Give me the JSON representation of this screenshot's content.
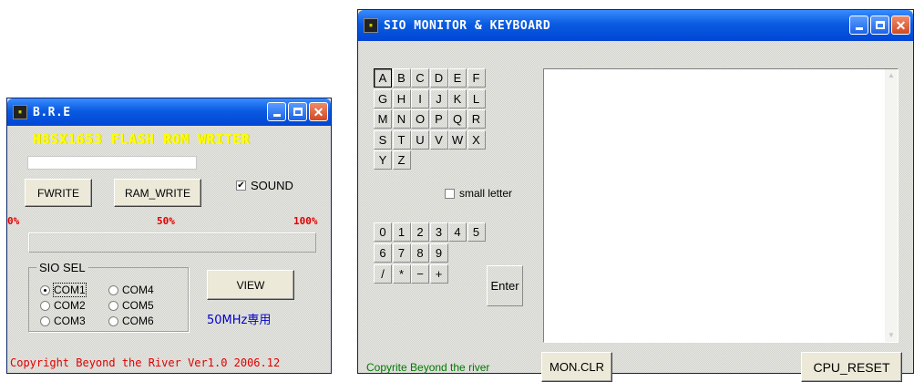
{
  "bre": {
    "title": "B.R.E",
    "header": "H8SX1653 FLASH ROM WRITER",
    "fwrite_label": "FWRITE",
    "ramwrite_label": "RAM_WRITE",
    "sound_label": "SOUND",
    "sound_checked": true,
    "scale": [
      "0%",
      "50%",
      "100%"
    ],
    "progress": 0,
    "sio_group_label": "SIO SEL",
    "com_ports": [
      "COM1",
      "COM2",
      "COM3",
      "COM4",
      "COM5",
      "COM6"
    ],
    "selected_com": "COM1",
    "view_label": "VIEW",
    "mhz_note": "50MHz専用",
    "copyright": "Copyright Beyond the River Ver1.0 2006.12"
  },
  "sio": {
    "title": "SIO MONITOR & KEYBOARD",
    "letter_keys": [
      "A",
      "B",
      "C",
      "D",
      "E",
      "F",
      "G",
      "H",
      "I",
      "J",
      "K",
      "L",
      "M",
      "N",
      "O",
      "P",
      "Q",
      "R",
      "S",
      "T",
      "U",
      "V",
      "W",
      "X",
      "Y",
      "Z"
    ],
    "selected_key": "A",
    "small_letter_label": "small letter",
    "small_letter_checked": false,
    "num_keys": [
      "0",
      "1",
      "2",
      "3",
      "4",
      "5",
      "6",
      "7",
      "8",
      "9",
      "/",
      "*",
      "−",
      "+"
    ],
    "enter_label": "Enter",
    "footer_text": "Copyrite Beyond the river",
    "monclr_label": "MON.CLR",
    "cpureset_label": "CPU_RESET",
    "monitor_text": ""
  },
  "colors": {
    "title_blue": "#0a5be0",
    "header_yellow": "#ffff00",
    "red": "#e00000",
    "blue_text": "#0000cc",
    "green_text": "#007a00"
  },
  "icons": {
    "app": "app-chip-icon",
    "min": "minimize-icon",
    "max": "maximize-icon",
    "close": "close-icon"
  }
}
